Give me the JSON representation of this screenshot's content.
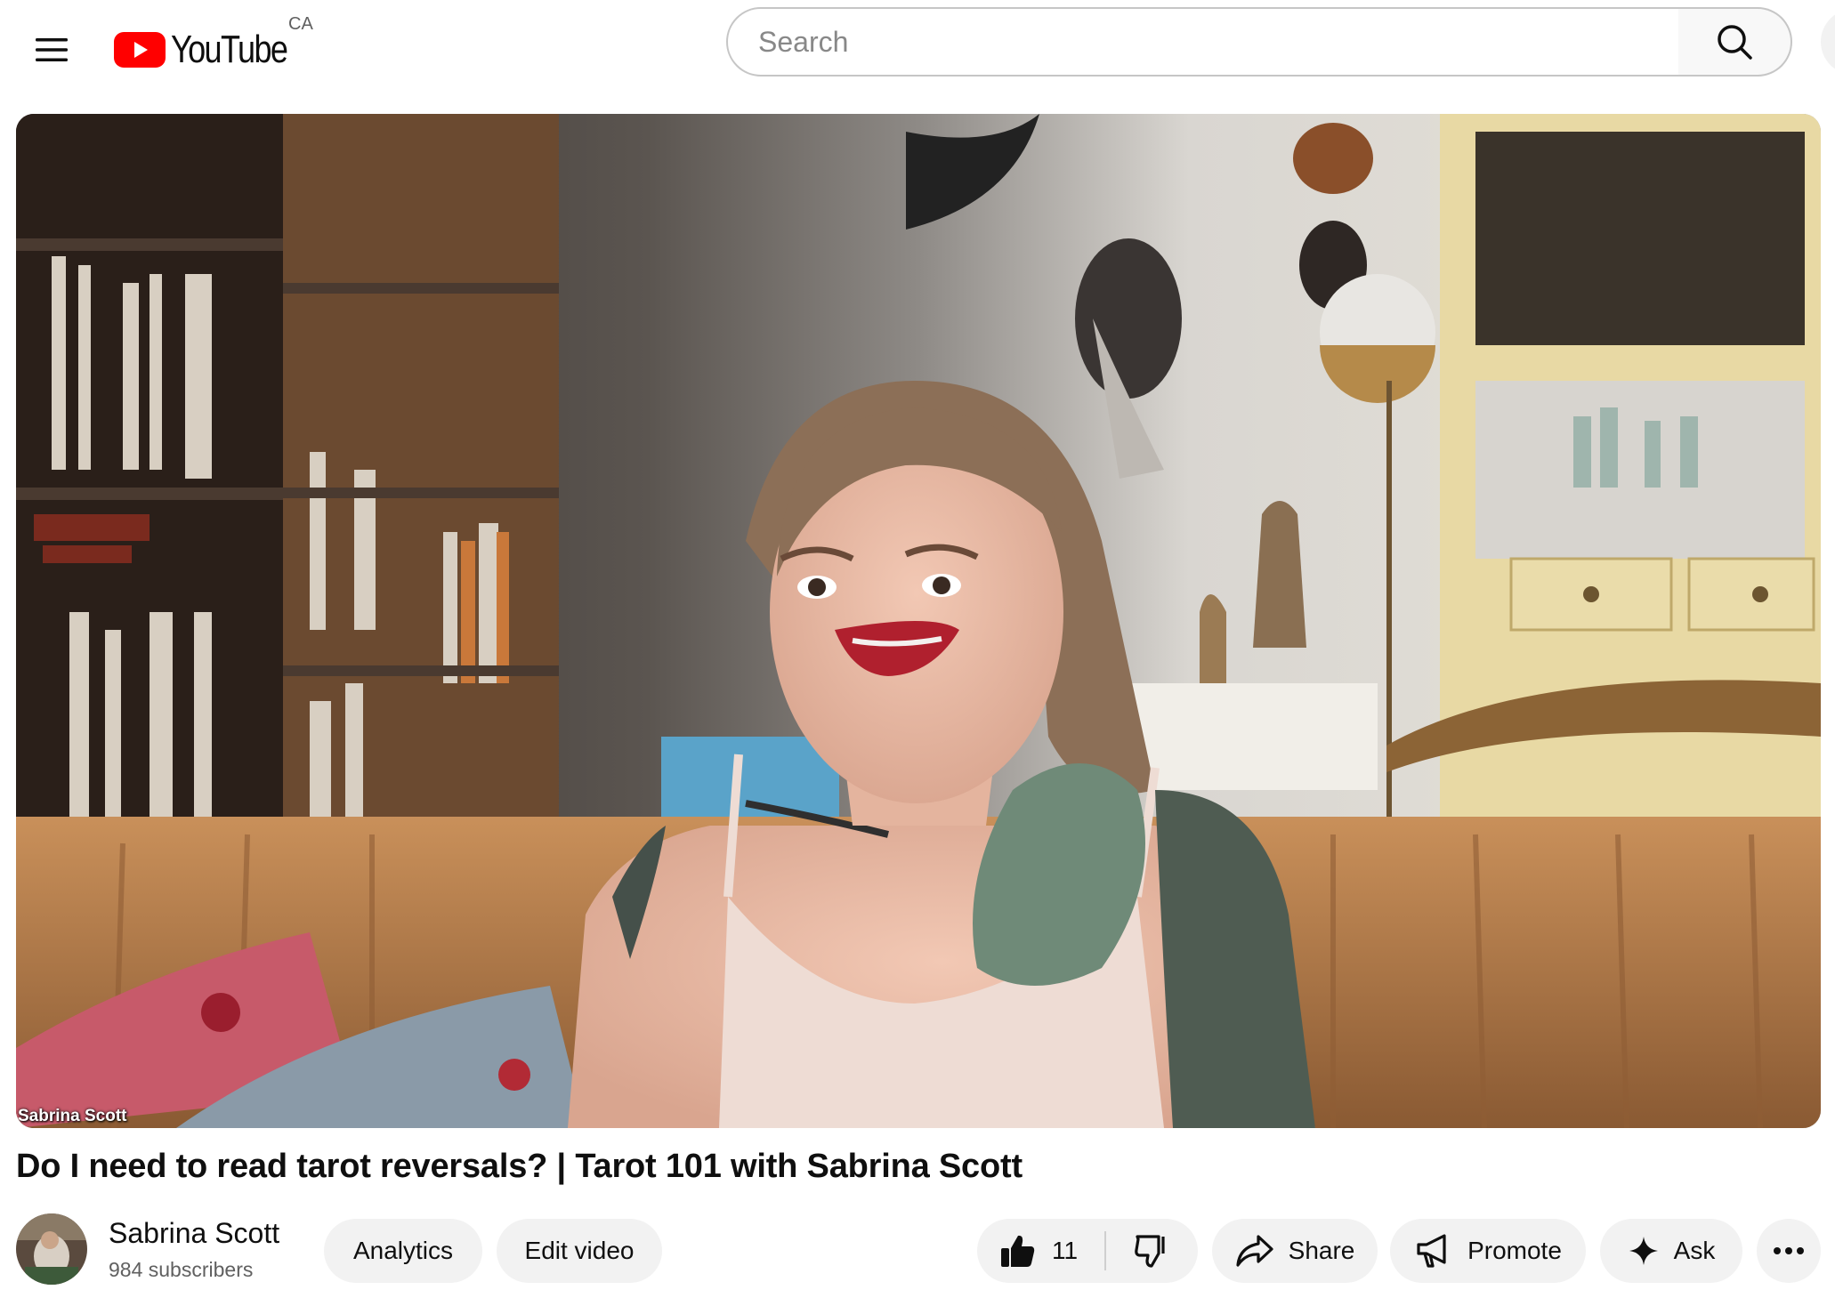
{
  "masthead": {
    "logo_text": "YouTube",
    "country_code": "CA",
    "search_placeholder": "Search"
  },
  "player": {
    "watermark": "Sabrina Scott"
  },
  "video": {
    "title": "Do I need to read tarot reversals? | Tarot 101 with Sabrina Scott"
  },
  "channel": {
    "name": "Sabrina Scott",
    "subscribers": "984 subscribers"
  },
  "actions": {
    "analytics": "Analytics",
    "edit_video": "Edit video",
    "like_count": "11",
    "share": "Share",
    "promote": "Promote",
    "ask": "Ask"
  },
  "colors": {
    "brand_red": "#ff0000",
    "pill_bg": "#f2f2f2",
    "text_primary": "#0f0f0f",
    "text_secondary": "#606060"
  },
  "icons": [
    "menu-icon",
    "youtube-logo-icon",
    "search-icon",
    "like-icon",
    "dislike-icon",
    "share-icon",
    "promote-icon",
    "sparkle-icon",
    "more-icon"
  ]
}
